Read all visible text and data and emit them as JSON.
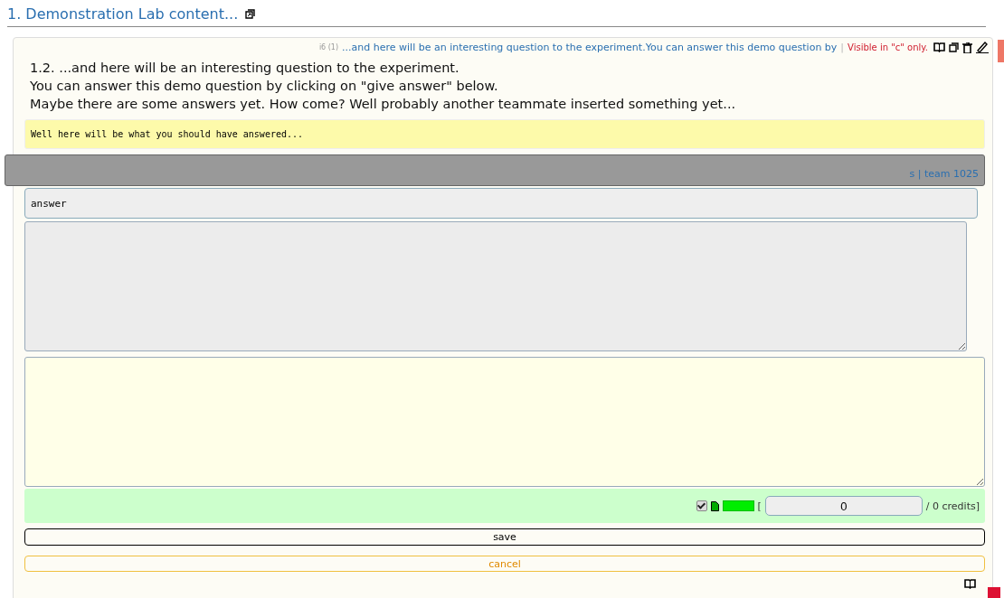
{
  "heading": {
    "title": "1. Demonstration Lab content..."
  },
  "question": {
    "tag": "i6 (1)",
    "summary": "...and here will be an interesting question to the experiment.You can answer this demo question by",
    "separator": "|",
    "visibility": "Visible in \"c\" only.",
    "lines": [
      "1.2. ...and here will be an interesting question to the experiment.",
      "You can answer this demo question by clicking on \"give answer\" below.",
      "Maybe there are some answers yet. How come? Well probably another teammate inserted something yet..."
    ],
    "model_answer": "Well here will be what you should have answered..."
  },
  "team_bar": {
    "label": "s | team 1025"
  },
  "answer_field": {
    "value": "answer"
  },
  "grading": {
    "checked": true,
    "open_bracket": "[",
    "points": "0",
    "credits": "/ 0 credits]"
  },
  "buttons": [
    {
      "label": "save",
      "kind": "save"
    },
    {
      "label": "cancel",
      "kind": "cancel"
    }
  ]
}
